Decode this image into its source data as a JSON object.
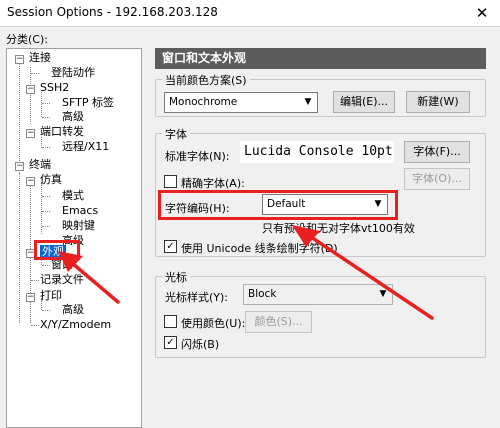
{
  "window": {
    "title": "Session Options - 192.168.203.128",
    "close_glyph": "✕"
  },
  "category_label": "分类(C):",
  "tree": [
    "连接",
    "登陆动作",
    "SSH2",
    "SFTP 标签",
    "高级",
    "端口转发",
    "远程/X11",
    "终端",
    "仿真",
    "模式",
    "Emacs",
    "映射键",
    "高级",
    "外观",
    "窗口",
    "记录文件",
    "打印",
    "高级",
    "X/Y/Zmodem"
  ],
  "header": "窗口和文本外观",
  "scheme": {
    "group_label": "当前颜色方案(S)",
    "selected": "Monochrome",
    "edit_button": "编辑(E)...",
    "new_button": "新建(W)"
  },
  "font": {
    "group_label": "字体",
    "standard_label": "标准字体(N):",
    "standard_value": "Lucida Console 10pt",
    "font_button": "字体(F)...",
    "precise_label": "精确字体(A):",
    "font_button_disabled": "字体(O)...",
    "encoding_label": "字符编码(H):",
    "encoding_value": "Default",
    "hint": "只有预设和无对字体vt100有效",
    "unicode_label": "使用 Unicode 线条绘制字符(D)"
  },
  "cursor": {
    "group_label": "光标",
    "style_label": "光标样式(Y):",
    "style_value": "Block",
    "use_color_label": "使用颜色(U):",
    "color_button": "颜色(S)...",
    "blink_label": "闪烁(B)"
  },
  "colors": {
    "selection": "#0a64d6",
    "header_bg": "#5c5c5c",
    "annotation": "#e82020"
  }
}
